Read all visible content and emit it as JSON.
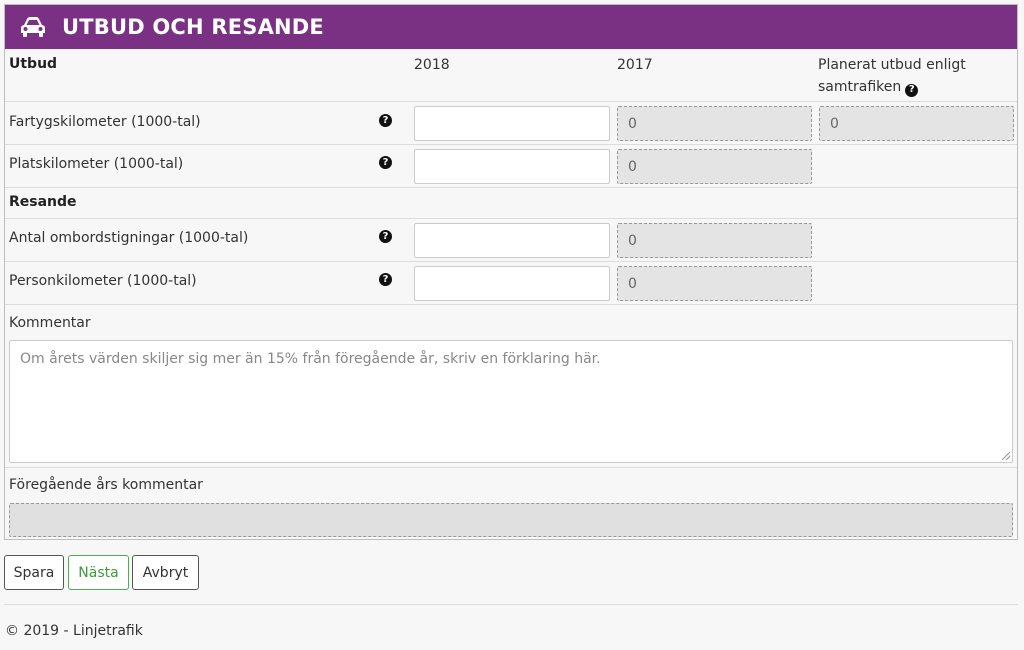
{
  "header": {
    "title": "UTBUD OCH RESANDE",
    "icon": "car-icon"
  },
  "utbud": {
    "section_label": "Utbud",
    "col_2018": "2018",
    "col_2017": "2017",
    "col_planned": "Planerat utbud enligt samtrafiken",
    "rows": [
      {
        "label": "Fartygskilometer (1000-tal)",
        "value_2018": "",
        "value_2017": "0",
        "value_planned": "0"
      },
      {
        "label": "Platskilometer (1000-tal)",
        "value_2018": "",
        "value_2017": "0"
      }
    ]
  },
  "resande": {
    "section_label": "Resande",
    "rows": [
      {
        "label": "Antal ombordstigningar (1000-tal)",
        "value_2018": "",
        "value_2017": "0"
      },
      {
        "label": "Personkilometer (1000-tal)",
        "value_2018": "",
        "value_2017": "0"
      }
    ]
  },
  "comment": {
    "label": "Kommentar",
    "placeholder": "Om årets värden skiljer sig mer än 15% från föregående år, skriv en förklaring här."
  },
  "previous_comment": {
    "label": "Föregående års kommentar",
    "value": ""
  },
  "help_glyph": "?",
  "buttons": {
    "save": "Spara",
    "next": "Nästa",
    "cancel": "Avbryt"
  },
  "footer": {
    "text": "© 2019 - Linjetrafik"
  },
  "colors": {
    "header_bg": "#7a3184",
    "next_button": "#4caf50"
  }
}
